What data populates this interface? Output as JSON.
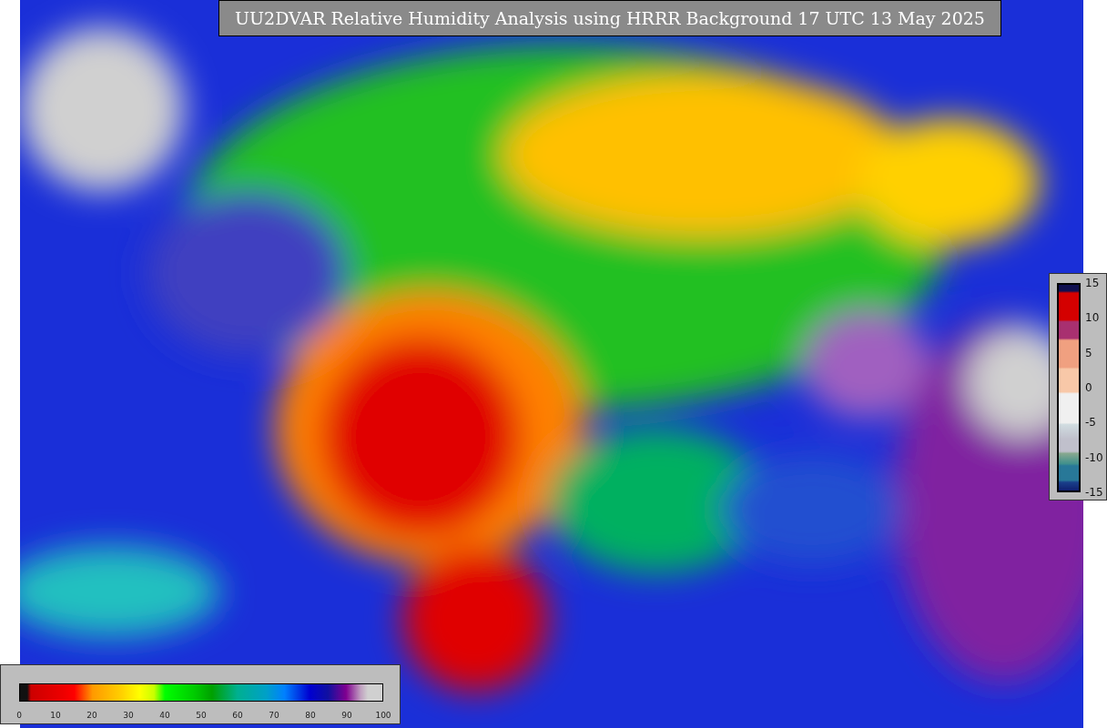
{
  "title": "UU2DVAR Relative Humidity Analysis using HRRR Background 17 UTC 13 May 2025",
  "humidity_colorbar": {
    "ticks": [
      "0",
      "10",
      "20",
      "30",
      "40",
      "50",
      "60",
      "70",
      "80",
      "90",
      "100"
    ]
  },
  "change_colorbar": {
    "ticks": [
      "15",
      "10",
      "5",
      "0",
      "-5",
      "-10",
      "-15"
    ]
  }
}
